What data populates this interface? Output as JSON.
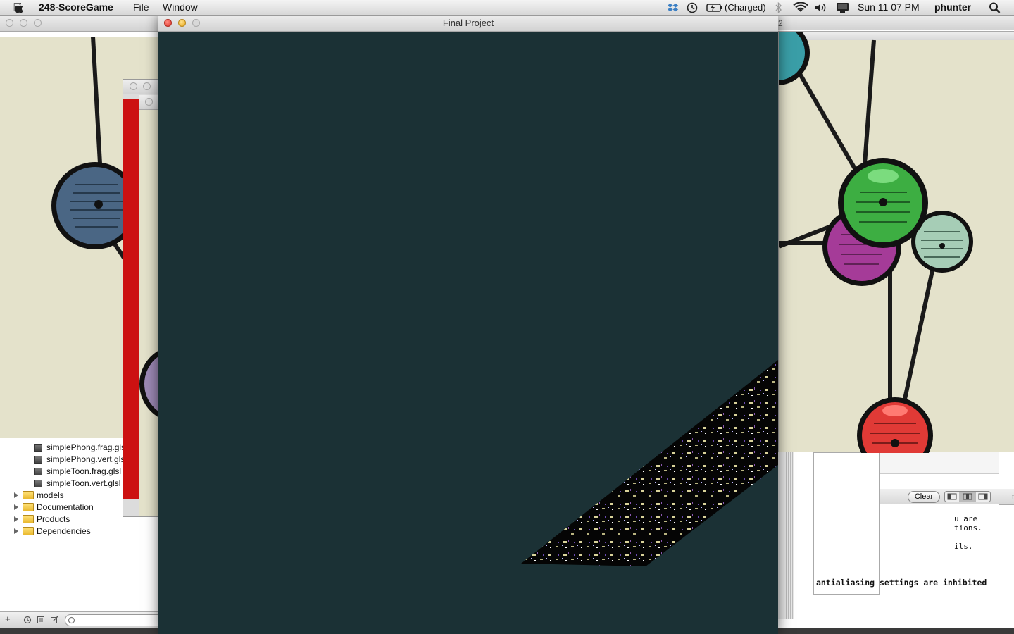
{
  "menubar": {
    "app_name": "248-ScoreGame",
    "menus": [
      "File",
      "Window"
    ],
    "status": {
      "battery": "(Charged)",
      "clock": "Sun 11 07 PM",
      "user": "phunter"
    }
  },
  "main_window": {
    "title": "Final Project",
    "background_color": "#1b3135"
  },
  "navigator": {
    "files": [
      "simplePhong.frag.glsl",
      "simplePhong.vert.glsl",
      "simpleToon.frag.glsl",
      "simpleToon.vert.glsl"
    ],
    "folders": [
      "models",
      "Documentation",
      "Products",
      "Dependencies"
    ]
  },
  "console": {
    "clear_label": "Clear",
    "lines": [
      "u are",
      "tions.",
      "",
      "ils."
    ],
    "bold_line": "antialiasing settings are inhibited",
    "cut_chars": [
      "2",
      "t"
    ]
  },
  "colors": {
    "graph_bg": "#e4e2cb",
    "node_blue": "#4a6684",
    "node_green": "#3dae42",
    "node_purple": "#a53b98",
    "node_mint": "#a6cdb6",
    "node_red": "#e03a36",
    "node_teal": "#3a9ea7",
    "red_panel": "#cc1111"
  }
}
